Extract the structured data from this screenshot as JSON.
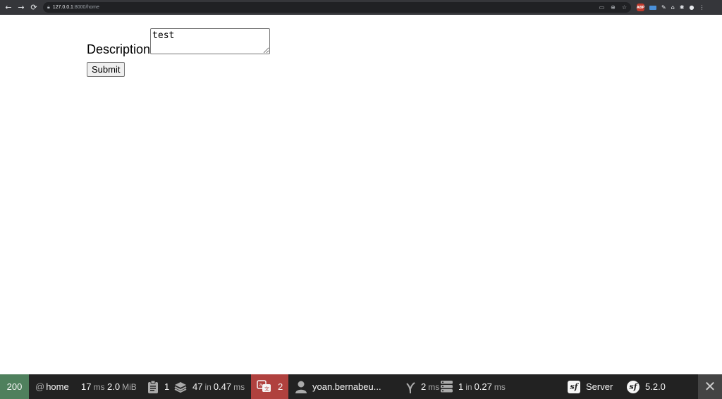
{
  "browser": {
    "url_host": "127.0.0.1",
    "url_path": ":8000/home"
  },
  "form": {
    "label": "Description",
    "textarea_value": "test",
    "submit_label": "Submit"
  },
  "toolbar": {
    "status_code": "200",
    "route_at": "@",
    "route": "home",
    "time_value": "17",
    "time_unit": "ms",
    "memory_value": "2.0",
    "memory_unit": "MiB",
    "forms_count": "1",
    "cache_calls": "47",
    "cache_in": "in",
    "cache_time": "0.47",
    "cache_unit": "ms",
    "translation_count": "2",
    "user": "yoan.bernabeu...",
    "twig_time": "2",
    "twig_unit": "ms",
    "db_queries": "1",
    "db_in": "in",
    "db_time": "0.27",
    "db_unit": "ms",
    "server_label": "Server",
    "version": "5.2.0",
    "close_symbol": "✕",
    "colors": {
      "status_bg": "#4f805d",
      "translation_bg": "#b0413e",
      "toolbar_bg": "#222222"
    }
  }
}
